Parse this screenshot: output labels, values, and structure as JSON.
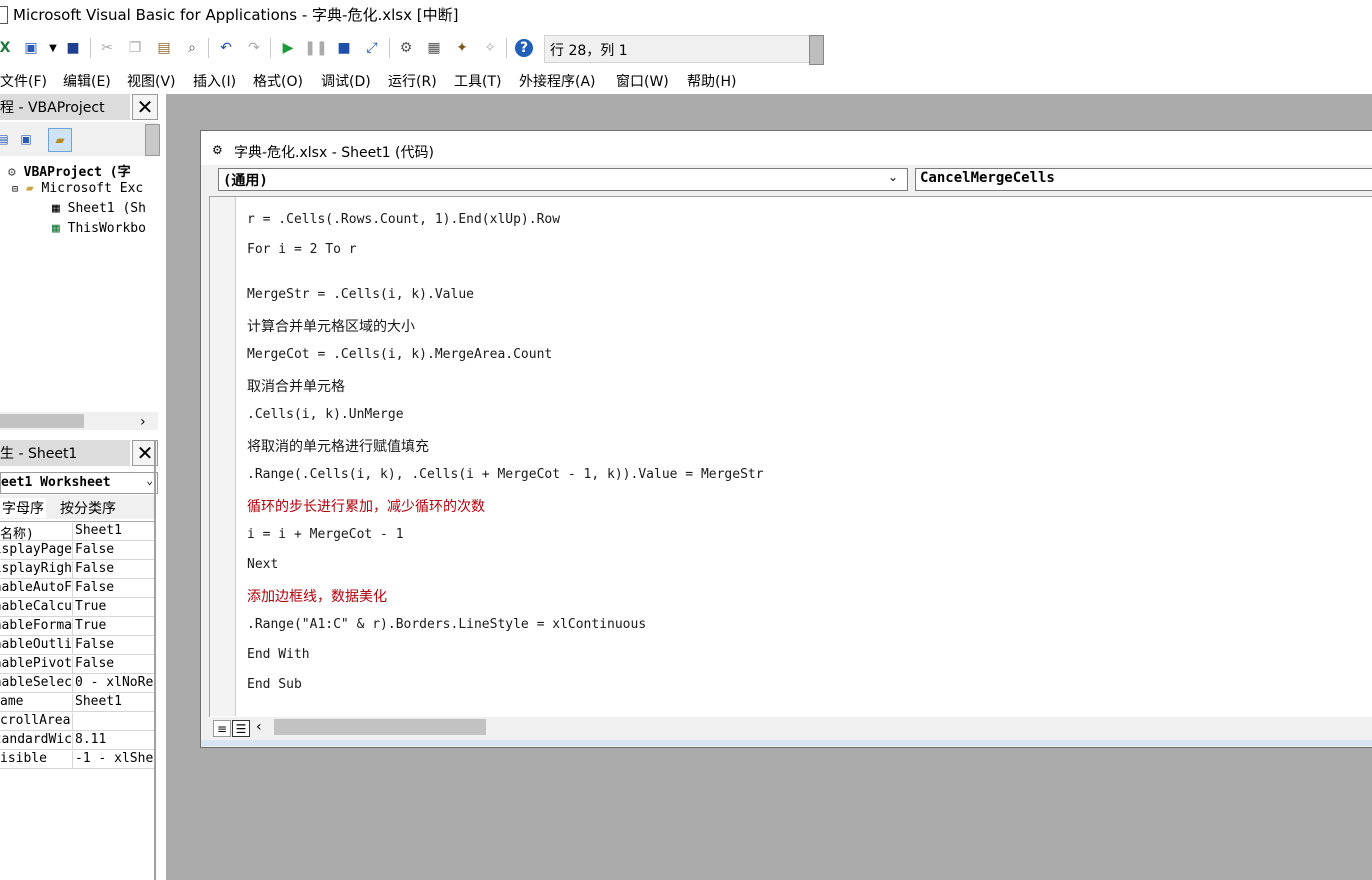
{
  "window": {
    "title": "Microsoft Visual Basic for Applications - 字典-危化.xlsx [中断]"
  },
  "toolbar": {
    "position_label": "行 28，列 1",
    "icons": [
      "excel-icon",
      "insert-userform-icon",
      "dropdown-icon",
      "save-icon",
      "cut-icon",
      "copy-icon",
      "paste-icon",
      "find-icon",
      "undo-icon",
      "redo-icon",
      "run-icon",
      "break-icon",
      "reset-icon",
      "design-mode-icon",
      "project-explorer-icon",
      "properties-icon",
      "object-browser-icon",
      "toolbox-icon",
      "help-icon"
    ]
  },
  "menu": [
    {
      "label": "文件(F)"
    },
    {
      "label": "编辑(E)"
    },
    {
      "label": "视图(V)"
    },
    {
      "label": "插入(I)"
    },
    {
      "label": "格式(O)"
    },
    {
      "label": "调试(D)"
    },
    {
      "label": "运行(R)"
    },
    {
      "label": "工具(T)"
    },
    {
      "label": "外接程序(A)"
    },
    {
      "label": "窗口(W)"
    },
    {
      "label": "帮助(H)"
    }
  ],
  "project_pane": {
    "title": "程 - VBAProject",
    "close": "✕",
    "tree": [
      {
        "label": "VBAProject (字"
      },
      {
        "label": "Microsoft Exc"
      },
      {
        "label": "Sheet1 (Sh"
      },
      {
        "label": "ThisWorkbo"
      }
    ],
    "scroll_right": "›"
  },
  "properties_pane": {
    "title": "生 - Sheet1",
    "close": "✕",
    "object_select": "eet1 Worksheet",
    "tabs": [
      "字母序",
      "按分类序"
    ],
    "rows": [
      {
        "name": "名称)",
        "value": "Sheet1"
      },
      {
        "name": "isplayPage",
        "value": "False"
      },
      {
        "name": "isplayRigh",
        "value": "False"
      },
      {
        "name": "nableAutoF",
        "value": "False"
      },
      {
        "name": "nableCalcu",
        "value": "True"
      },
      {
        "name": "nableForma",
        "value": "True"
      },
      {
        "name": "nableOutli",
        "value": "False"
      },
      {
        "name": "nablePivot",
        "value": "False"
      },
      {
        "name": "nableSelec",
        "value": "0 - xlNoRe"
      },
      {
        "name": "ame",
        "value": "Sheet1"
      },
      {
        "name": "crollArea",
        "value": ""
      },
      {
        "name": "tandardWic",
        "value": "8.11"
      },
      {
        "name": "isible",
        "value": "-1 - xlShe"
      }
    ]
  },
  "code_window": {
    "title": "字典-危化.xlsx - Sheet1 (代码)",
    "object_combo": "(通用)",
    "proc_combo": "CancelMergeCells",
    "lines": [
      {
        "text": "r = .Cells(.Rows.Count, 1).End(xlUp).Row",
        "comment": false
      },
      {
        "text": "For i = 2 To r",
        "comment": false
      },
      {
        "text": "MergeStr = .Cells(i, k).Value",
        "comment": false
      },
      {
        "text": "计算合并单元格区域的大小",
        "comment": false
      },
      {
        "text": "MergeCot = .Cells(i, k).MergeArea.Count",
        "comment": false
      },
      {
        "text": "取消合并单元格",
        "comment": false
      },
      {
        "text": ".Cells(i, k).UnMerge",
        "comment": false
      },
      {
        "text": "将取消的单元格进行赋值填充",
        "comment": false
      },
      {
        "text": ".Range(.Cells(i, k), .Cells(i + MergeCot - 1, k)).Value = MergeStr",
        "comment": false
      },
      {
        "text": "循环的步长进行累加，减少循环的次数",
        "comment": true
      },
      {
        "text": "i = i + MergeCot - 1",
        "comment": false
      },
      {
        "text": "Next",
        "comment": false
      },
      {
        "text": "添加边框线，数据美化",
        "comment": true
      },
      {
        "text": ".Range(\"A1:C\" & r).Borders.LineStyle = xlContinuous",
        "comment": false
      },
      {
        "text": "End With",
        "comment": false
      },
      {
        "text": "End Sub",
        "comment": false
      }
    ],
    "comment_color": "#b3000b"
  }
}
